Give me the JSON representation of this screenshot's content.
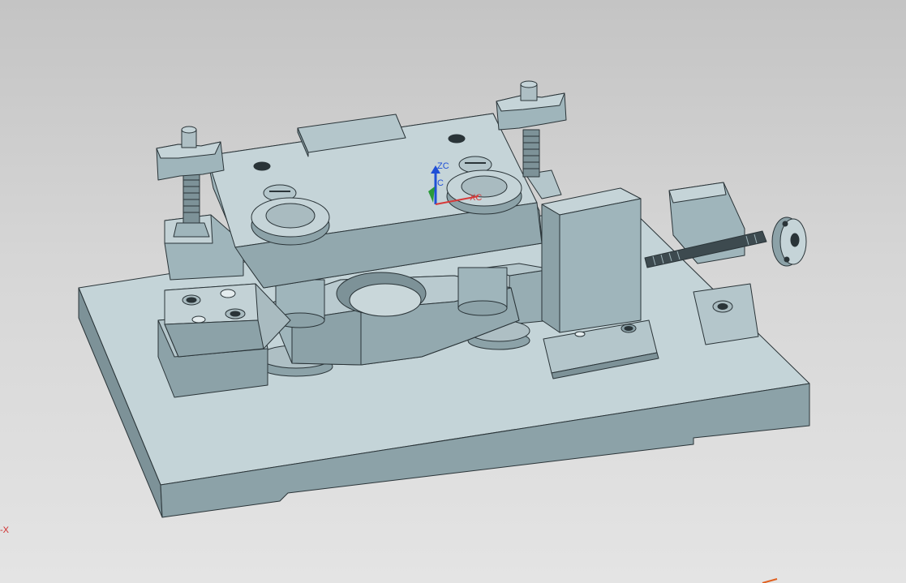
{
  "viewport": {
    "background_top": "#c4c4c4",
    "background_bottom": "#e4e4e4",
    "model_color": "#9fb5bb",
    "edge_color": "#2a3438"
  },
  "wcs_triad": {
    "z_label": "ZC",
    "x_label": "XC",
    "y_label": "C",
    "z_color": "#1f4fd6",
    "x_color": "#d63a3a",
    "y_color": "#2a9a3a"
  },
  "view_triad": {
    "axis_label": "-X",
    "color": "#d02a2a"
  }
}
